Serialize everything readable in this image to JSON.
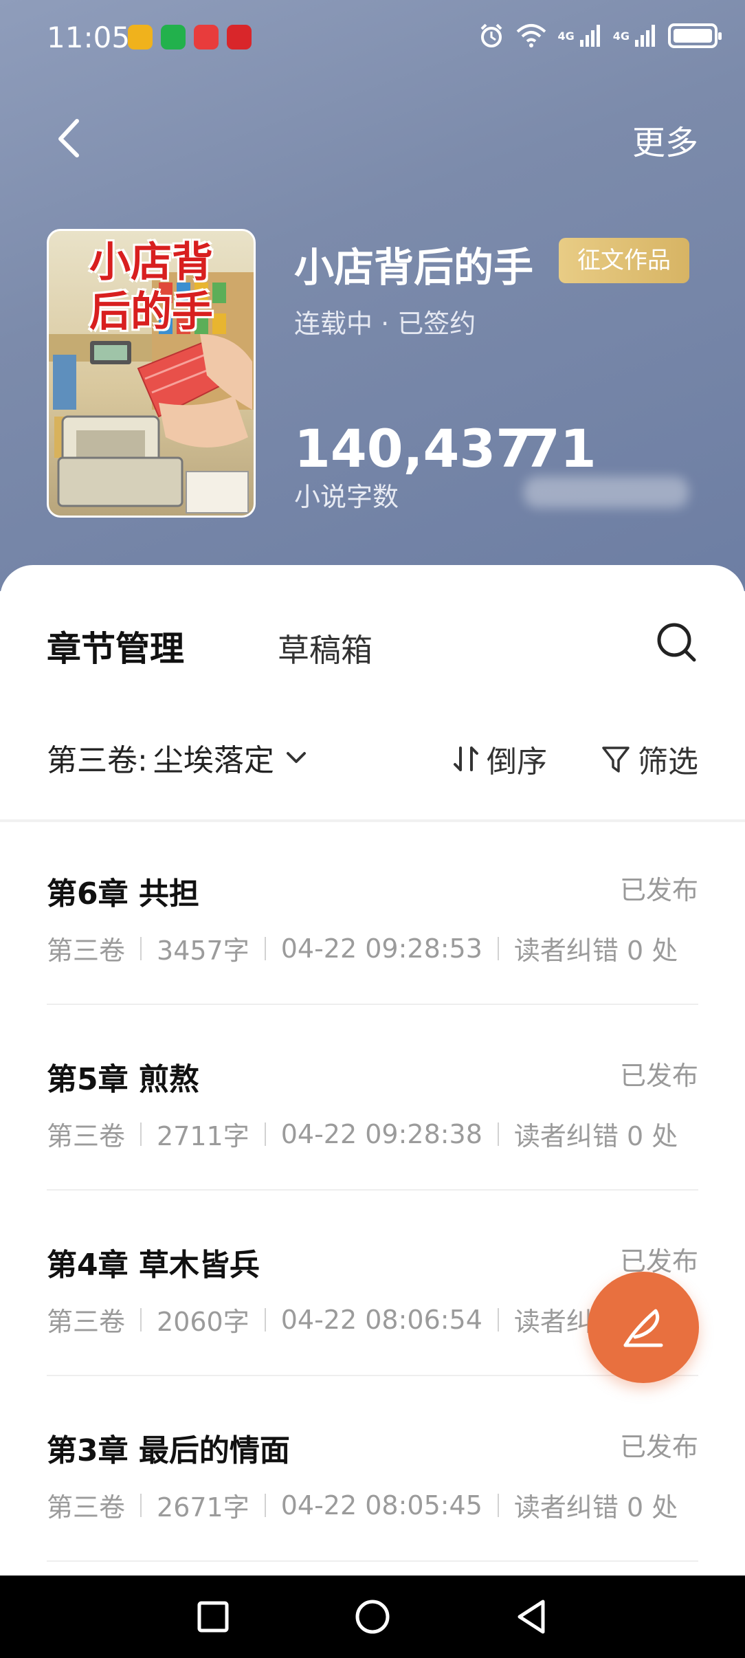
{
  "status_bar": {
    "time": "11:05",
    "network_label_1": "4G",
    "network_label_2": "4G"
  },
  "header": {
    "more_label": "更多",
    "book": {
      "cover_title": "小店背\n后的手",
      "title": "小店背后的手",
      "tag": "征文作品",
      "status": "连载中 · 已签约",
      "word_count": "140,437",
      "word_count_label": "小说字数",
      "second_stat": "71"
    }
  },
  "tabs": {
    "active": "章节管理",
    "inactive": "草稿箱"
  },
  "toolbar": {
    "volume_prefix": "第三卷:",
    "volume_name": "尘埃落定",
    "sort_label": "倒序",
    "filter_label": "筛选"
  },
  "chapters": [
    {
      "title": "第6章 共担",
      "status": "已发布",
      "volume": "第三卷",
      "words": "3457字",
      "time": "04-22 09:28:53",
      "errata": "读者纠错 0 处"
    },
    {
      "title": "第5章 煎熬",
      "status": "已发布",
      "volume": "第三卷",
      "words": "2711字",
      "time": "04-22 09:28:38",
      "errata": "读者纠错 0 处"
    },
    {
      "title": "第4章 草木皆兵",
      "status": "已发布",
      "volume": "第三卷",
      "words": "2060字",
      "time": "04-22 08:06:54",
      "errata": "读者纠错 0 处"
    },
    {
      "title": "第3章 最后的情面",
      "status": "已发布",
      "volume": "第三卷",
      "words": "2671字",
      "time": "04-22 08:05:45",
      "errata": "读者纠错 0 处"
    }
  ],
  "colors": {
    "accent": "#e8703f",
    "tag": "#d7b464",
    "header_bg": "#7c8bab"
  },
  "icons": [
    "back-icon",
    "search-icon",
    "chevron-down-icon",
    "sort-icon",
    "filter-icon",
    "write-icon",
    "nav-recents-icon",
    "nav-home-icon",
    "nav-back-icon"
  ]
}
